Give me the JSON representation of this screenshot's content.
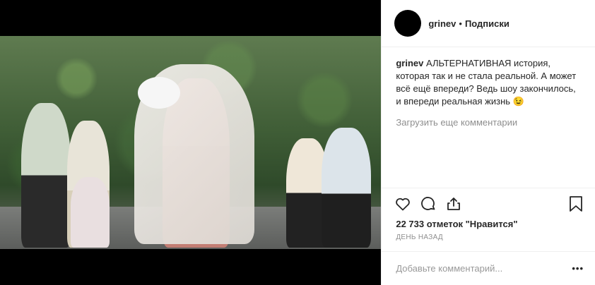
{
  "post": {
    "username": "grinev",
    "separator": "•",
    "follow_label": "Подписки",
    "caption_user": "grinev",
    "caption_text": "АЛЬТЕРНАТИВНАЯ история, которая так и не стала реальной. А может всё ещё впереди? Ведь шоу закончилось, и впереди реальная жизнь 😉",
    "load_more": "Загрузить еще комментарии",
    "likes": "22 733 отметок \"Нравится\"",
    "time": "ДЕНЬ НАЗАД",
    "add_comment_placeholder": "Добавьте комментарий...",
    "more_label": "•••"
  },
  "icons": [
    "heart-icon",
    "comment-icon",
    "share-icon",
    "bookmark-icon"
  ]
}
